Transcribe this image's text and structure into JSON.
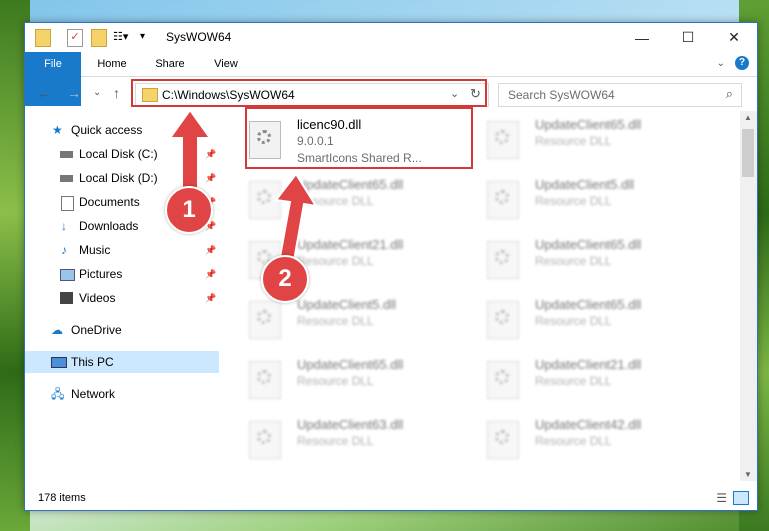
{
  "window": {
    "title": "SysWOW64"
  },
  "ribbon": {
    "tabs": [
      "File",
      "Home",
      "Share",
      "View"
    ]
  },
  "address": {
    "path": "C:\\Windows\\SysWOW64"
  },
  "search": {
    "placeholder": "Search SysWOW64"
  },
  "sidebar": {
    "items": [
      {
        "label": "Quick access"
      },
      {
        "label": "Local Disk (C:)"
      },
      {
        "label": "Local Disk (D:)"
      },
      {
        "label": "Documents"
      },
      {
        "label": "Downloads"
      },
      {
        "label": "Music"
      },
      {
        "label": "Pictures"
      },
      {
        "label": "Videos"
      },
      {
        "label": "OneDrive"
      },
      {
        "label": "This PC"
      },
      {
        "label": "Network"
      }
    ]
  },
  "files": [
    {
      "name": "licenc90.dll",
      "line1": "9.0.0.1",
      "line2": "SmartIcons Shared R..."
    },
    {
      "name": "UpdateClient65.dll",
      "line1": "Resource DLL"
    },
    {
      "name": "UpdateClient65.dll",
      "line1": "Resource DLL"
    },
    {
      "name": "UpdateClient5.dll",
      "line1": "Resource DLL"
    },
    {
      "name": "UpdateClient21.dll",
      "line1": "Resource DLL"
    },
    {
      "name": "UpdateClient65.dll",
      "line1": "Resource DLL"
    },
    {
      "name": "UpdateClient5.dll",
      "line1": "Resource DLL"
    },
    {
      "name": "UpdateClient65.dll",
      "line1": "Resource DLL"
    },
    {
      "name": "UpdateClient65.dll",
      "line1": "Resource DLL"
    },
    {
      "name": "UpdateClient21.dll",
      "line1": "Resource DLL"
    },
    {
      "name": "UpdateClient63.dll",
      "line1": "Resource DLL"
    },
    {
      "name": "UpdateClient42.dll",
      "line1": "Resource DLL"
    }
  ],
  "status": {
    "count": "178 items"
  },
  "annotations": {
    "one": "1",
    "two": "2"
  },
  "colors": {
    "accent": "#1979ca",
    "highlight": "#d23a3a",
    "selected": "#cce8ff"
  }
}
